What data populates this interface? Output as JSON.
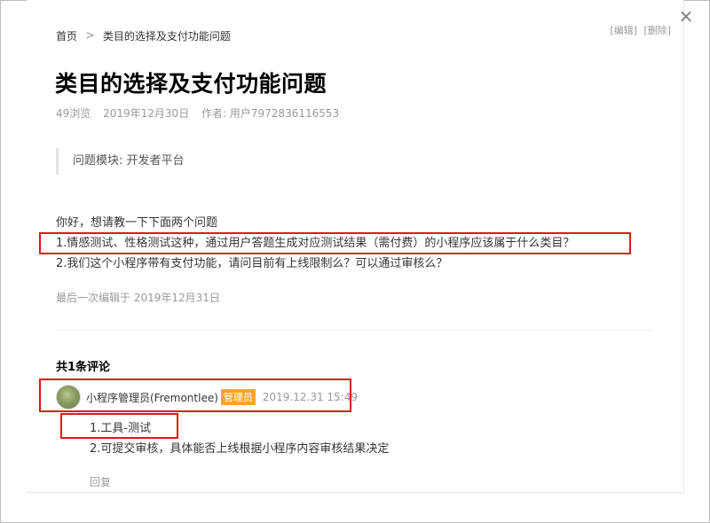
{
  "breadcrumb": {
    "home": "首页",
    "separator": ">",
    "current": "类目的选择及支付功能问题"
  },
  "actions": {
    "edit": "[编辑]",
    "delete": "[删除]"
  },
  "close_label": "×",
  "post": {
    "title": "类目的选择及支付功能问题",
    "views": "49浏览",
    "date": "2019年12月30日",
    "author": "作者: 用户7972836116553",
    "module": "问题模块: 开发者平台",
    "lines": [
      "你好，想请教一下下面两个问题",
      "1.情感测试、性格测试这种，通过用户答题生成对应测试结果（需付费）的小程序应该属于什么类目？",
      "2.我们这个小程序带有支付功能，请问目前有上线限制么？可以通过审核么？"
    ],
    "last_edited": "最后一次编辑于 2019年12月31日"
  },
  "comments": {
    "count_label": "共1条评论",
    "items": [
      {
        "user": "小程序管理员(Fremontlee)",
        "badge": "管理员",
        "time": "2019.12.31 15:49",
        "lines": [
          "1.工具-测试",
          "2.可提交审核，具体能否上线根据小程序内容审核结果决定"
        ],
        "reply": "回复"
      }
    ]
  },
  "colors": {
    "highlight_box": "#e0161a",
    "admin_badge": "#f3a533",
    "muted_text": "#9a9a9a"
  }
}
